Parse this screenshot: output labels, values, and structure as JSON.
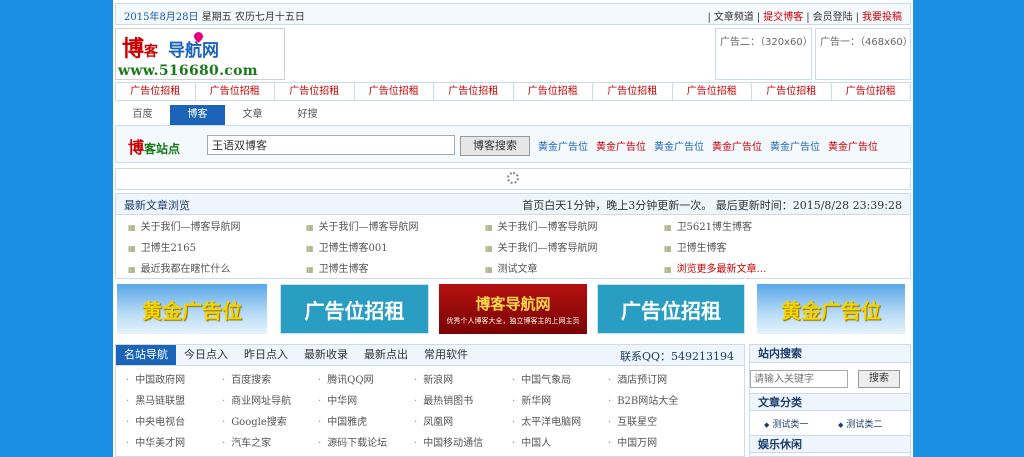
{
  "topbar": {
    "date_main": "2015年8月28日",
    "date_rest": "星期五 农历七月十五日",
    "links": [
      {
        "label": "文章频道",
        "red": false
      },
      {
        "label": "提交博客",
        "red": true
      },
      {
        "label": "会员登陆",
        "red": false
      },
      {
        "label": "我要投稿",
        "red": true
      }
    ]
  },
  "logo": {
    "line1_a": "博",
    "line1_b": "客",
    "line1_c": "导航网",
    "line2": "www.516680.com"
  },
  "ads": {
    "ad2": "广告二：（320x60）",
    "ad1": "广告一：（468x60）"
  },
  "adrow": [
    "广告位招租",
    "广告位招租",
    "广告位招租",
    "广告位招租",
    "广告位招租",
    "广告位招租",
    "广告位招租",
    "广告位招租",
    "广告位招租",
    "广告位招租"
  ],
  "search": {
    "tabs": [
      "百度",
      "博客",
      "文章",
      "好搜"
    ],
    "active_tab": 1,
    "logo_a": "博",
    "logo_b": "客",
    "logo_c": "站点",
    "input_value": "王语双博客",
    "button": "博客搜索",
    "gold_links": [
      "黄金广告位",
      "黄金广告位",
      "黄金广告位",
      "黄金广告位",
      "黄金广告位",
      "黄金广告位"
    ]
  },
  "latest": {
    "title": "最新文章浏览",
    "update_note": "首页白天1分钟，晚上3分钟更新一次。 最后更新时间：2015/8/28 23:39:28",
    "items": [
      [
        "关于我们—博客导航网",
        "关于我们—博客导航网",
        "关于我们—博客导航网",
        "卫5621博生博客"
      ],
      [
        "卫博生2165",
        "卫博生博客001",
        "关于我们—博客导航网",
        "卫博生博客"
      ],
      [
        "最近我都在瞎忙什么",
        "卫博生博客",
        "测试文章",
        "浏览更多最新文章…"
      ]
    ]
  },
  "banners": [
    "黄金广告位",
    "广告位招租",
    "博客导航网",
    "广告位招租",
    "黄金广告位"
  ],
  "banner_sub": "优秀个人博客大全，独立博客主的上网主页",
  "nav": {
    "tabs": [
      "名站导航",
      "今日点入",
      "昨日点入",
      "最新收录",
      "最新点出",
      "常用软件"
    ],
    "active": 0,
    "qq": "联系QQ：549213194",
    "rows": [
      [
        "中国政府网",
        "百度搜索",
        "腾讯QQ网",
        "新浪网",
        "中国气象局",
        "酒店预订网"
      ],
      [
        "黑马链联盟",
        "商业网址导航",
        "中华网",
        "最热销图书",
        "新华网",
        "B2B网站大全"
      ],
      [
        "中央电视台",
        "Google搜索",
        "中国雅虎",
        "凤凰网",
        "太平洋电脑网",
        "互联星空"
      ],
      [
        "中华美才网",
        "汽车之家",
        "源码下载论坛",
        "中国移动通信",
        "中国人",
        "中国万网"
      ]
    ]
  },
  "side": {
    "search_title": "站内搜索",
    "placeholder": "请输入关键字",
    "button": "搜索",
    "cat_title": "文章分类",
    "cats": [
      "测试类一",
      "测试类二"
    ],
    "fun_title": "娱乐休闲"
  },
  "colors": {
    "background": "#1a8fe3",
    "accent": "#1c64b8",
    "red": "#cc0000"
  }
}
